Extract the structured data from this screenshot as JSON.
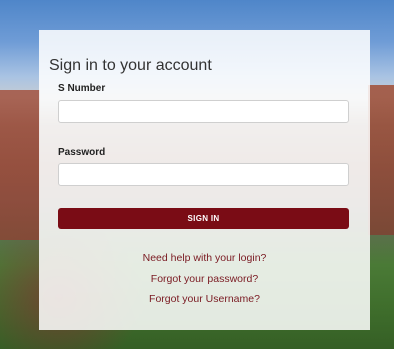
{
  "login": {
    "title": "Sign in to your account",
    "snumber_label": "S Number",
    "snumber_value": "",
    "password_label": "Password",
    "password_value": "",
    "signin_button": "SIGN IN"
  },
  "links": {
    "login_help": "Need help with your login?",
    "forgot_password": "Forgot your password?",
    "forgot_username": "Forgot your Username?"
  },
  "colors": {
    "accent": "#7a0c15",
    "link": "#7a1a22",
    "card": "#ffffff"
  }
}
